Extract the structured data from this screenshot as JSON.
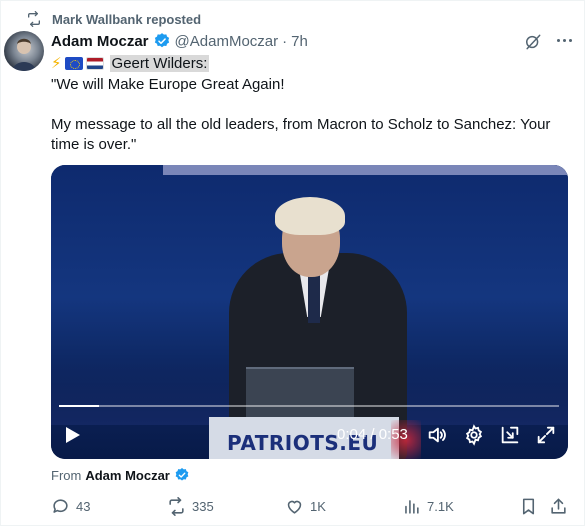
{
  "repost": {
    "text": "Mark Wallbank reposted",
    "icon": "repost-icon"
  },
  "author": {
    "name": "Adam Moczar",
    "handle": "@AdamMoczar",
    "separator": "·",
    "time": "7h"
  },
  "tagline": {
    "lightning": "⚡",
    "flag1": "eu-flag",
    "flag2": "netherlands-flag",
    "highlight": "Geert Wilders:"
  },
  "body": {
    "line1": "\"We will Make Europe Great Again!",
    "line2": "My message to all the old leaders, from Macron to Scholz to Sanchez: Your time is over.\""
  },
  "video": {
    "banner": "PATRIOTS.EU",
    "time": "0:04 / 0:53",
    "progress_fraction": 0.08
  },
  "from": {
    "label": "From",
    "name": "Adam Moczar"
  },
  "actions": {
    "replies": "43",
    "reposts": "335",
    "likes": "1K",
    "views": "7.1K"
  },
  "colors": {
    "accent": "#1d9bf0",
    "muted": "#536471",
    "text": "#0f1419"
  }
}
